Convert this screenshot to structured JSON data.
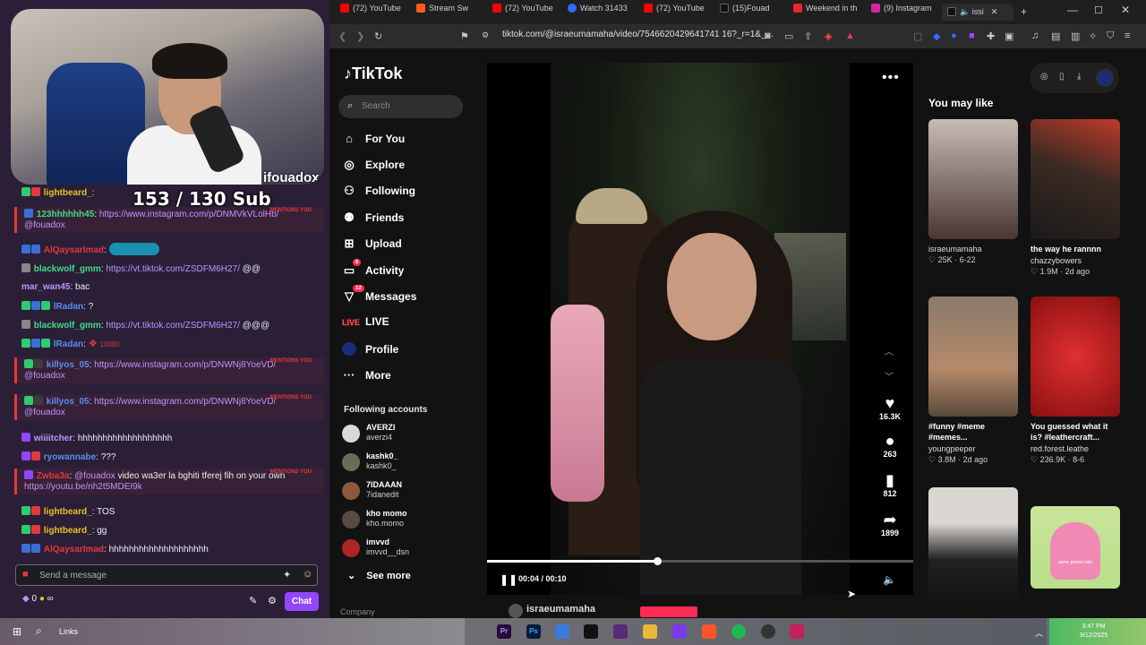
{
  "overlay": {
    "streamer_name": "ifouadox",
    "sub_goal": "153 / 130 Sub",
    "mention_tag": "MENTIONS YOU",
    "chat": [
      {
        "user": "lightbeard_",
        "sep": ":",
        "text": "",
        "link": "",
        "mention": false
      },
      {
        "user": "123hhhhhh45",
        "sep": ":",
        "text": "",
        "link": "https://www.instagram.com/p/DNMVkVLolHb/",
        "line2": "@fouadox",
        "mention": true
      },
      {
        "user": "AlQaysarImad",
        "sep": ":",
        "text": "",
        "link": "",
        "mention": false
      },
      {
        "user": "blackwolf_gmm",
        "sep": ":",
        "text": "@@",
        "link": "https://vt.tiktok.com/ZSDFM6H27/",
        "mention": false
      },
      {
        "user": "mar_wan45",
        "sep": ":",
        "text": "bac",
        "link": "",
        "mention": false
      },
      {
        "user": "lRadan",
        "sep": ":",
        "text": "?",
        "link": "",
        "mention": false
      },
      {
        "user": "blackwolf_gmm",
        "sep": ":",
        "text": "@@@",
        "link": "https://vt.tiktok.com/ZSDFM6H27/",
        "mention": false
      },
      {
        "user": "lRadan",
        "sep": ":",
        "text": "10000",
        "link": "",
        "mention": false
      },
      {
        "user": "killyos_05",
        "sep": ":",
        "text": "",
        "link": "https://www.instagram.com/p/DNWNj8YoeVD/",
        "line2": "@fouadox",
        "mention": true
      },
      {
        "user": "killyos_05",
        "sep": ":",
        "text": "",
        "link": "https://www.instagram.com/p/DNWNj8YoeVD/",
        "line2": "@fouadox",
        "mention": true
      },
      {
        "user": "wiiiitcher",
        "sep": ":",
        "text": "hhhhhhhhhhhhhhhhhhh",
        "link": "",
        "mention": false
      },
      {
        "user": "ryowannabe",
        "sep": ":",
        "text": "???",
        "link": "",
        "mention": false
      },
      {
        "user": "Zwba3a",
        "sep": ":",
        "text": "video wa3er la bghiti tferej fih on your own",
        "link": "",
        "prefix": "@fouadox",
        "line2": "https://youtu.be/nh2t5MDEI9k",
        "mention": true
      },
      {
        "user": "lightbeard_",
        "sep": ":",
        "text": "TOS",
        "link": "",
        "mention": false
      },
      {
        "user": "lightbeard_",
        "sep": ":",
        "text": "gg",
        "link": "",
        "mention": false
      },
      {
        "user": "AlQaysarImad",
        "sep": ":",
        "text": "hhhhhhhhhhhhhhhhhhhh",
        "link": "",
        "mention": false
      }
    ],
    "chat_placeholder": "Send a message",
    "points": "0",
    "infinity": "∞",
    "chat_button": "Chat"
  },
  "browser": {
    "tabs": [
      {
        "label": "(72) YouTube",
        "color": "#ff0000"
      },
      {
        "label": "Stream Sw",
        "color": "#ff5a1f"
      },
      {
        "label": "(72) YouTube",
        "color": "#ff0000"
      },
      {
        "label": "Watch 31433",
        "color": "#2d6bff"
      },
      {
        "label": "(72) YouTube",
        "color": "#ff0000"
      },
      {
        "label": "(15)Fouad",
        "color": "#111111"
      },
      {
        "label": "Weekend in th",
        "color": "#e4252b"
      },
      {
        "label": "(9) Instagram",
        "color": "#d6249f"
      },
      {
        "label": "issi",
        "color": "#111111"
      }
    ],
    "url": "tiktok.com/@israeumamaha/video/7546620429641741 16?_r=1&_..."
  },
  "tiktok": {
    "logo": "TikTok",
    "search_placeholder": "Search",
    "nav": [
      {
        "label": "For You",
        "icon": "home-icon"
      },
      {
        "label": "Explore",
        "icon": "compass-icon"
      },
      {
        "label": "Following",
        "icon": "following-icon"
      },
      {
        "label": "Friends",
        "icon": "friends-icon"
      },
      {
        "label": "Upload",
        "icon": "upload-icon"
      },
      {
        "label": "Activity",
        "icon": "activity-icon",
        "badge": "6"
      },
      {
        "label": "Messages",
        "icon": "messages-icon",
        "badge": "12"
      },
      {
        "label": "LIVE",
        "icon": "live-icon"
      },
      {
        "label": "Profile",
        "icon": "profile-icon"
      },
      {
        "label": "More",
        "icon": "more-icon"
      }
    ],
    "following_title": "Following accounts",
    "accounts": [
      {
        "name": "AVERZI",
        "handle": "averzi4",
        "color": "#d8d8d8"
      },
      {
        "name": "kashk0_",
        "handle": "kashk0_",
        "color": "#6b6b5a"
      },
      {
        "name": "7IDAAAN",
        "handle": "7idanedit",
        "color": "#8a5a3a"
      },
      {
        "name": "kho momo",
        "handle": "kho.momo",
        "color": "#5a4a44"
      },
      {
        "name": "imvvd",
        "handle": "imvvd__dsn",
        "color": "#b02424"
      }
    ],
    "see_more": "See more",
    "company": "Company",
    "video": {
      "likes": "16.3K",
      "comments": "263",
      "saves": "812",
      "shares": "1899",
      "time": "00:04 / 00:10",
      "progress": 0.4,
      "author": "israeumamaha"
    },
    "you_may_like": "You may like",
    "cards": [
      {
        "title": "",
        "user": "israeumamaha",
        "meta": "♡ 25K · 6-22",
        "c1": "#bfb3a8",
        "c2": "#5a3e3a"
      },
      {
        "title": "the way he rannnn",
        "user": "chazzybowers",
        "meta": "♡ 1.9M · 2d ago",
        "c1": "#3a2a22",
        "c2": "#c0392b"
      },
      {
        "title": "#funny #meme #memes...",
        "user": "youngpeeper",
        "meta": "♡ 3.8M · 2d ago",
        "c1": "#7a6a5a",
        "c2": "#b58a6a"
      },
      {
        "title": "You guessed what it is? #leathercraft...",
        "user": "red.forest.leathe",
        "meta": "♡ 236.9K · 8-6",
        "c1": "#d42a2a",
        "c2": "#8a1010"
      },
      {
        "title": "",
        "user": "",
        "meta": "",
        "c1": "#d9d5d0",
        "c2": "#222222"
      },
      {
        "title": "",
        "user": "",
        "meta": "",
        "c1": "#b9e08a",
        "c2": "#f08ab4",
        "sticker": "same person btw"
      }
    ]
  },
  "taskbar": {
    "search_label": "Links",
    "apps": [
      "Pr",
      "Ps",
      "",
      "",
      "",
      "",
      "",
      "",
      "",
      "",
      "",
      ""
    ],
    "time": "3:47 PM",
    "date": "9/12/2025"
  }
}
